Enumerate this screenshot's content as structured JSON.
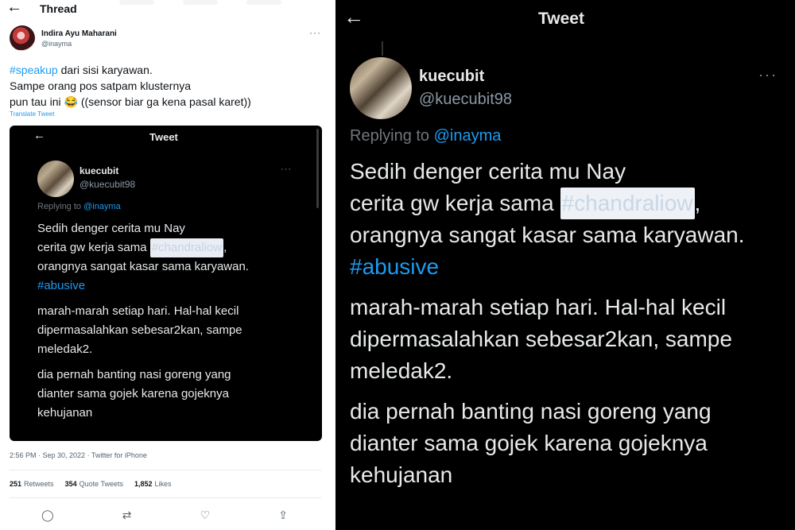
{
  "thread": {
    "back_icon": "arrow-left-icon",
    "title": "Thread",
    "author": {
      "name": "Indira Ayu Maharani",
      "handle": "@inayma",
      "more": "···"
    },
    "text": {
      "hashtag": "#speakup",
      "line1_rest": " dari sisi karyawan.",
      "line2": "Sampe orang pos satpam klusternya",
      "line3": "pun tau ini 😂 ((sensor biar ga kena pasal karet))"
    },
    "translate": "Translate Tweet",
    "timestamp": "2:56 PM · Sep 30, 2022 · Twitter for iPhone",
    "stats": {
      "retweets_count": "251",
      "retweets_label": "Retweets",
      "quotes_count": "354",
      "quotes_label": "Quote Tweets",
      "likes_count": "1,852",
      "likes_label": "Likes"
    },
    "actions": {
      "reply": "◯",
      "retweet": "⇄",
      "like": "♡",
      "share": "⇪"
    }
  },
  "embedded_tweet": {
    "header_title": "Tweet",
    "back": "←",
    "more": "···",
    "author_name": "kuecubit",
    "author_handle": "@kuecubit98",
    "replying_to_label": "Replying to ",
    "replying_to_mention": "@inayma",
    "body": {
      "p1_l1": "Sedih denger cerita mu Nay",
      "p1_l2_pre": "cerita gw kerja sama ",
      "p1_l2_censored": "#chandraliow",
      "p1_l2_post": ",",
      "p1_l3": "orangnya sangat kasar sama karyawan.",
      "p1_hashtag": "#abusive",
      "p2_l1": "marah-marah setiap hari. Hal-hal kecil",
      "p2_l2": "dipermasalahkan sebesar2kan, sampe",
      "p2_l3": "meledak2.",
      "p3_l1": "dia pernah banting nasi goreng yang",
      "p3_l2": "dianter sama gojek karena gojeknya",
      "p3_l3": "kehujanan"
    }
  },
  "colors": {
    "link": "#1d9bf0",
    "dark_bg": "#000000",
    "dark_text": "#e7e9ea",
    "muted": "#536471"
  }
}
